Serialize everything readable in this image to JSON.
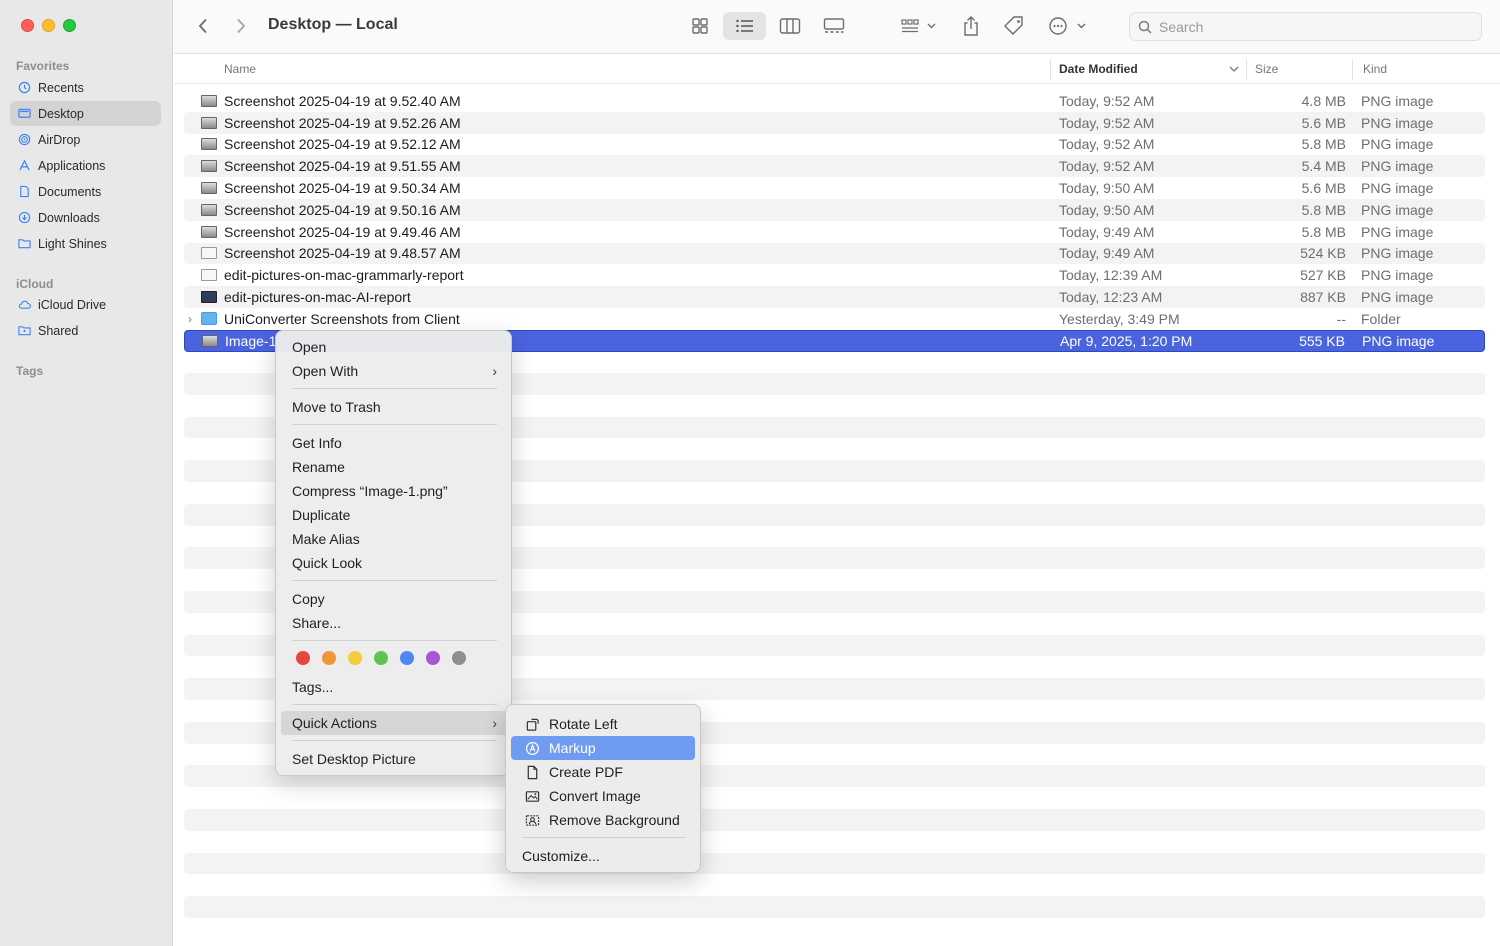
{
  "window": {
    "title": "Desktop — Local"
  },
  "sidebar": {
    "favorites_label": "Favorites",
    "favorites": [
      {
        "label": "Recents",
        "icon": "clock-icon"
      },
      {
        "label": "Desktop",
        "icon": "desktop-icon",
        "active": true
      },
      {
        "label": "AirDrop",
        "icon": "airdrop-icon"
      },
      {
        "label": "Applications",
        "icon": "applications-icon"
      },
      {
        "label": "Documents",
        "icon": "document-icon"
      },
      {
        "label": "Downloads",
        "icon": "download-icon"
      },
      {
        "label": "Light Shines",
        "icon": "folder-icon"
      }
    ],
    "icloud_label": "iCloud",
    "icloud": [
      {
        "label": "iCloud Drive",
        "icon": "cloud-icon"
      },
      {
        "label": "Shared",
        "icon": "shared-folder-icon"
      }
    ],
    "tags_label": "Tags"
  },
  "toolbar": {
    "search_placeholder": "Search"
  },
  "columns": {
    "name": "Name",
    "date": "Date Modified",
    "size": "Size",
    "kind": "Kind"
  },
  "files": [
    {
      "name": "Screenshot 2025-04-19 at 9.52.40 AM",
      "date": "Today, 9:52 AM",
      "size": "4.8 MB",
      "kind": "PNG image"
    },
    {
      "name": "Screenshot 2025-04-19 at 9.52.26 AM",
      "date": "Today, 9:52 AM",
      "size": "5.6 MB",
      "kind": "PNG image"
    },
    {
      "name": "Screenshot 2025-04-19 at 9.52.12 AM",
      "date": "Today, 9:52 AM",
      "size": "5.8 MB",
      "kind": "PNG image"
    },
    {
      "name": "Screenshot 2025-04-19 at 9.51.55 AM",
      "date": "Today, 9:52 AM",
      "size": "5.4 MB",
      "kind": "PNG image"
    },
    {
      "name": "Screenshot 2025-04-19 at 9.50.34 AM",
      "date": "Today, 9:50 AM",
      "size": "5.6 MB",
      "kind": "PNG image"
    },
    {
      "name": "Screenshot 2025-04-19 at 9.50.16 AM",
      "date": "Today, 9:50 AM",
      "size": "5.8 MB",
      "kind": "PNG image"
    },
    {
      "name": "Screenshot 2025-04-19 at 9.49.46 AM",
      "date": "Today, 9:49 AM",
      "size": "5.8 MB",
      "kind": "PNG image"
    },
    {
      "name": "Screenshot 2025-04-19 at 9.48.57 AM",
      "date": "Today, 9:49 AM",
      "size": "524 KB",
      "kind": "PNG image"
    },
    {
      "name": "edit-pictures-on-mac-grammarly-report",
      "date": "Today, 12:39 AM",
      "size": "527 KB",
      "kind": "PNG image"
    },
    {
      "name": "edit-pictures-on-mac-AI-report",
      "date": "Today, 12:23 AM",
      "size": "887 KB",
      "kind": "PNG image"
    },
    {
      "name": "UniConverter Screenshots from Client",
      "date": "Yesterday, 3:49 PM",
      "size": "--",
      "kind": "Folder"
    },
    {
      "name": "Image-1",
      "date": "Apr 9, 2025, 1:20 PM",
      "size": "555 KB",
      "kind": "PNG image"
    }
  ],
  "context_menu": {
    "open": "Open",
    "open_with": "Open With",
    "move_to_trash": "Move to Trash",
    "get_info": "Get Info",
    "rename": "Rename",
    "compress": "Compress “Image-1.png”",
    "duplicate": "Duplicate",
    "make_alias": "Make Alias",
    "quick_look": "Quick Look",
    "copy": "Copy",
    "share": "Share...",
    "tag_colors": [
      "#e5473f",
      "#f0963a",
      "#f2cd3d",
      "#5dc452",
      "#4f86f0",
      "#a856d1",
      "#8e8e8e"
    ],
    "tags": "Tags...",
    "quick_actions": "Quick Actions",
    "set_desktop_picture": "Set Desktop Picture"
  },
  "quick_actions_menu": {
    "rotate_left": "Rotate Left",
    "markup": "Markup",
    "create_pdf": "Create PDF",
    "convert_image": "Convert Image",
    "remove_background": "Remove Background",
    "customize": "Customize..."
  }
}
